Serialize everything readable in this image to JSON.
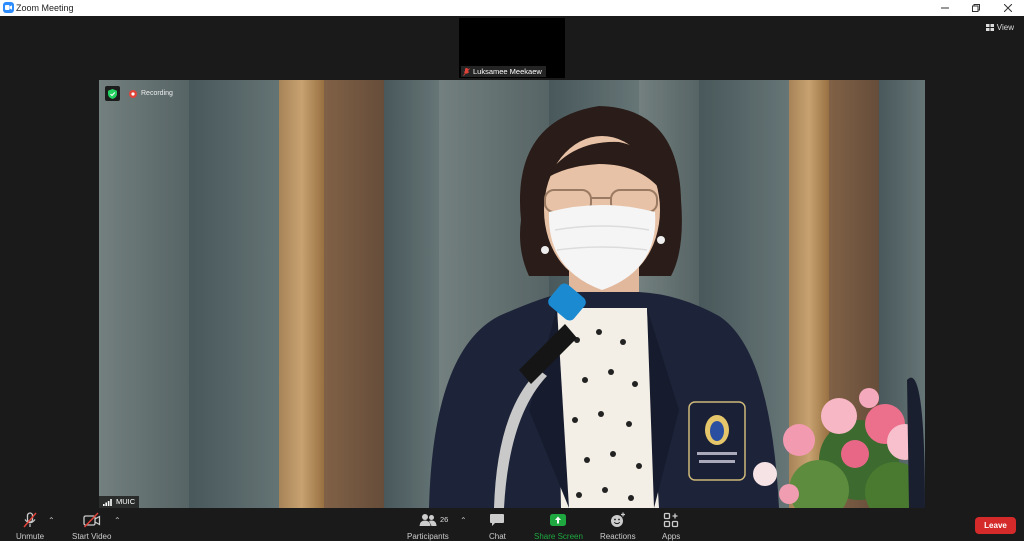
{
  "window": {
    "title": "Zoom Meeting"
  },
  "view_label": "View",
  "thumbnail": {
    "participant_name": "Luksamee Meekaew"
  },
  "main_video": {
    "recording_label": "Recording",
    "participant_name": "MUIC"
  },
  "toolbar": {
    "unmute": "Unmute",
    "start_video": "Start Video",
    "participants": "Participants",
    "participants_count": "26",
    "chat": "Chat",
    "share_screen": "Share Screen",
    "reactions": "Reactions",
    "apps": "Apps",
    "leave": "Leave"
  },
  "colors": {
    "accent": "#2D8CFF",
    "share_green": "#1ea83f",
    "leave_red": "#d52a2a",
    "muted_red": "#e0433a"
  }
}
